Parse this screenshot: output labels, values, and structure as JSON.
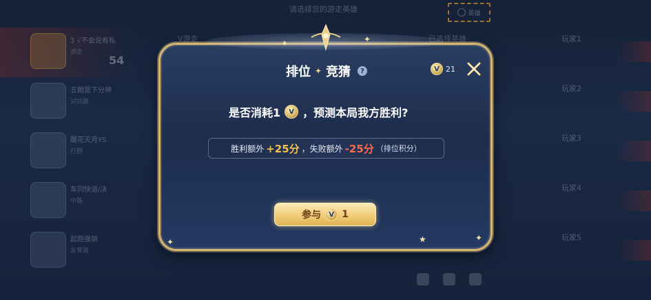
{
  "background": {
    "top_hint": "请选择您的游走英雄",
    "top_button_label": "英雄",
    "left_rows": [
      {
        "line1": "3 √不会说有私",
        "line2": "游走",
        "score": "54"
      },
      {
        "line1": "五朗是下分神",
        "line2": "对抗路",
        "score": ""
      },
      {
        "line1": "醒花灭月YS",
        "line2": "打野",
        "score": ""
      },
      {
        "line1": "车同快道/决",
        "line2": "中路",
        "score": ""
      },
      {
        "line1": "起跑强胡",
        "line2": "发育路",
        "score": ""
      }
    ],
    "mid_left_label": "V游走",
    "mid_right_label": "已选择英雄",
    "players": [
      "玩家1",
      "玩家2",
      "玩家3",
      "玩家4",
      "玩家5"
    ]
  },
  "dialog": {
    "title_left": "排位",
    "title_sep": "✦",
    "title_right": "竞猜",
    "help": "?",
    "coin_symbol": "V",
    "coin_count": "21",
    "question_prefix": "是否消耗1",
    "question_suffix": "，预测本局我方胜利?",
    "win_text": "胜利额外",
    "win_value": "+25分",
    "sep_text": "，失败额外",
    "lose_value": "-25分",
    "note": "（排位积分）",
    "join_label": "参与",
    "join_cost": "1"
  },
  "colors": {
    "frame_gold": "#d8b870",
    "win": "#f2c24a",
    "lose": "#ff6a4a",
    "button": "#f1cc78"
  },
  "icons": {
    "help": "question-circle-icon",
    "coin": "prediction-coin-icon",
    "close": "close-icon"
  }
}
